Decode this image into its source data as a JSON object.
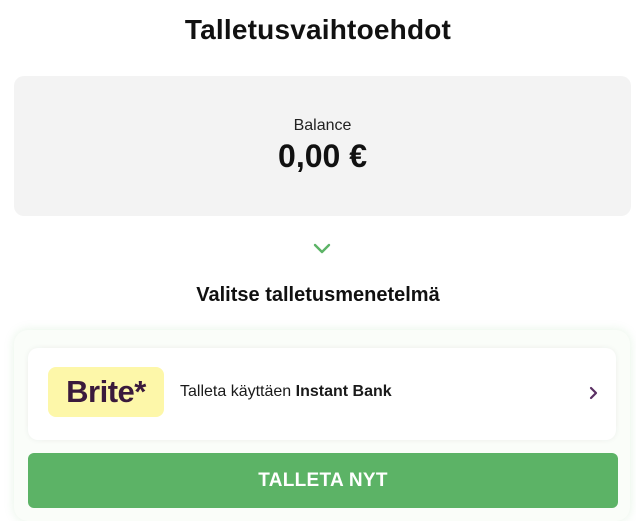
{
  "header": {
    "title": "Talletusvaihtoehdot"
  },
  "balance": {
    "label": "Balance",
    "amount": "0,00 €"
  },
  "methods_section": {
    "title": "Valitse talletusmenetelmä"
  },
  "methods": [
    {
      "logo_text": "Brite*",
      "prefix": "Talleta käyttäen",
      "name": "Instant Bank",
      "logo_bg": "#fdf7a9",
      "icon": "chevron-right-icon"
    }
  ],
  "actions": {
    "deposit_label": "TALLETA NYT"
  },
  "colors": {
    "accent": "#5cb366",
    "brand_text": "#3a1a3c",
    "chevron_accent": "#5a2f63"
  }
}
